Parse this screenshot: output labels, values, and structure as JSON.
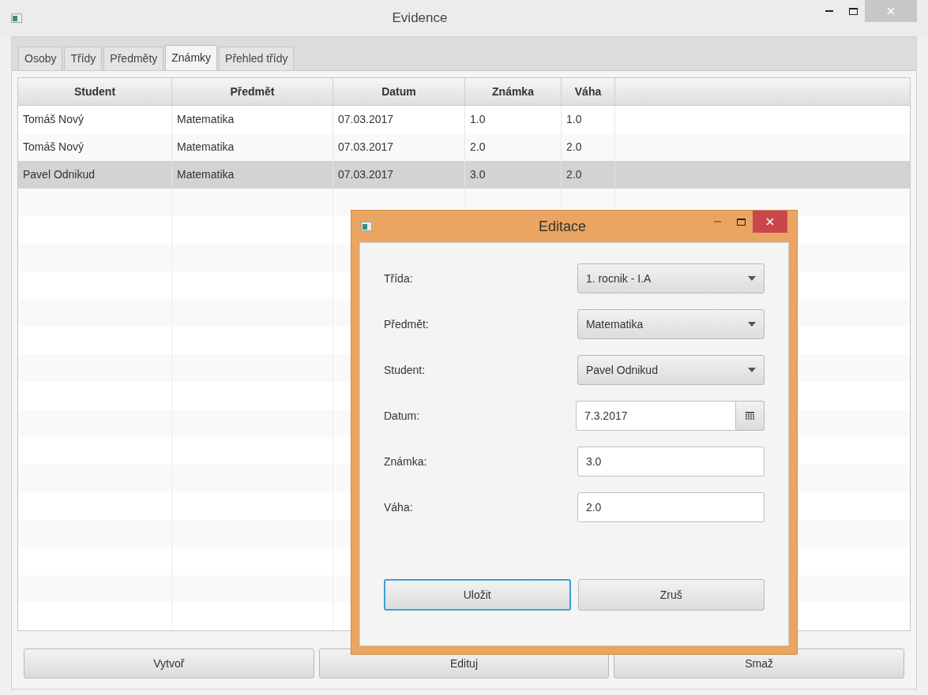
{
  "window": {
    "title": "Evidence"
  },
  "tabs": [
    {
      "label": "Osoby",
      "selected": false
    },
    {
      "label": "Třídy",
      "selected": false
    },
    {
      "label": "Předměty",
      "selected": false
    },
    {
      "label": "Známky",
      "selected": true
    },
    {
      "label": "Přehled třídy",
      "selected": false
    }
  ],
  "table": {
    "columns": [
      "Student",
      "Předmět",
      "Datum",
      "Známka",
      "Váha"
    ],
    "rows": [
      {
        "cells": [
          "Tomáš Nový",
          "Matematika",
          "07.03.2017",
          "1.0",
          "1.0"
        ],
        "selected": false
      },
      {
        "cells": [
          "Tomáš Nový",
          "Matematika",
          "07.03.2017",
          "2.0",
          "2.0"
        ],
        "selected": false
      },
      {
        "cells": [
          "Pavel Odnikud",
          "Matematika",
          "07.03.2017",
          "3.0",
          "2.0"
        ],
        "selected": true
      }
    ]
  },
  "buttons": [
    "Vytvoř",
    "Edituj",
    "Smaž"
  ],
  "dialog": {
    "title": "Editace",
    "fields": [
      {
        "label": "Třída:",
        "kind": "select",
        "value": "1. rocnik - I.A"
      },
      {
        "label": "Předmět:",
        "kind": "select",
        "value": "Matematika"
      },
      {
        "label": "Student:",
        "kind": "select",
        "value": "Pavel Odnikud"
      },
      {
        "label": "Datum:",
        "kind": "date",
        "value": "7.3.2017"
      },
      {
        "label": "Známka:",
        "kind": "text",
        "value": "3.0"
      },
      {
        "label": "Váha:",
        "kind": "text",
        "value": "2.0"
      }
    ],
    "buttons": [
      {
        "label": "Uložit",
        "focused": true
      },
      {
        "label": "Zruš",
        "focused": false
      }
    ]
  }
}
